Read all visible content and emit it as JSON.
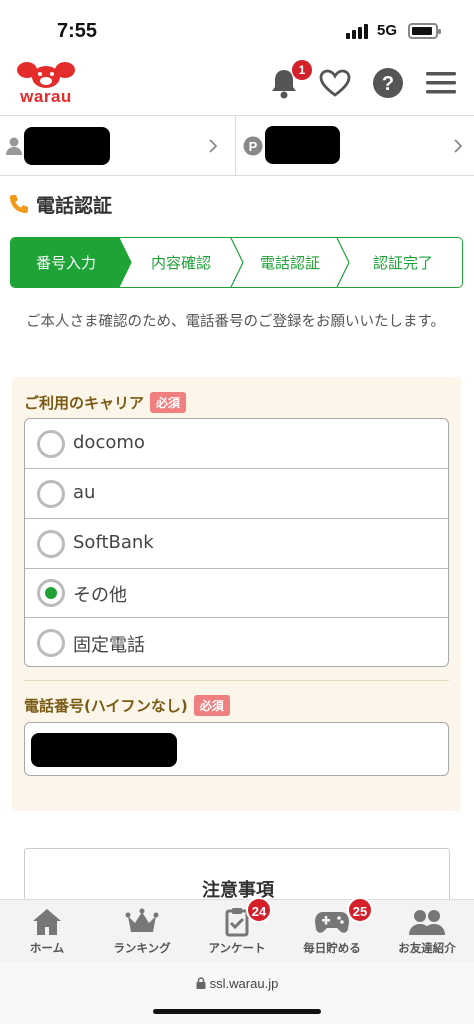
{
  "status": {
    "time": "7:55",
    "network": "5G"
  },
  "header": {
    "logo": "warau",
    "notification_count": "1"
  },
  "section": {
    "title": "電話認証"
  },
  "steps": [
    {
      "label": "番号入力",
      "active": true
    },
    {
      "label": "内容確認",
      "active": false
    },
    {
      "label": "電話認証",
      "active": false
    },
    {
      "label": "認証完了",
      "active": false
    }
  ],
  "intro": "ご本人さま確認のため、電話番号のご登録をお願いいたします。",
  "carrier": {
    "label": "ご利用のキャリア",
    "required": "必須",
    "options": [
      "docomo",
      "au",
      "SoftBank",
      "その他",
      "固定電話"
    ],
    "selected": "その他"
  },
  "phone": {
    "label": "電話番号(ハイフンなし)",
    "required": "必須"
  },
  "notice": {
    "title": "注意事項"
  },
  "bottom_nav": [
    {
      "label": "ホーム",
      "icon": "home-icon"
    },
    {
      "label": "ランキング",
      "icon": "crown-icon"
    },
    {
      "label": "アンケート",
      "icon": "survey-icon",
      "badge": "24"
    },
    {
      "label": "毎日貯める",
      "icon": "gamepad-icon",
      "badge": "25"
    },
    {
      "label": "お友達紹介",
      "icon": "friends-icon"
    }
  ],
  "url": "ssl.warau.jp",
  "colors": {
    "brand_red": "#e32c2b",
    "accent_green": "#1ea337",
    "badge_red": "#d3202a",
    "panel_bg": "#fbf6e9"
  }
}
